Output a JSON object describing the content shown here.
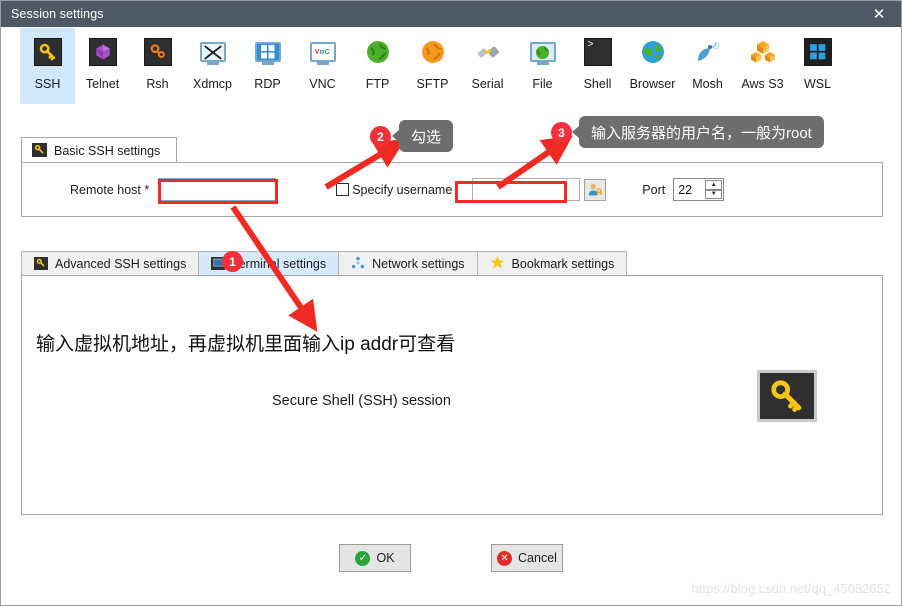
{
  "window": {
    "title": "Session settings",
    "close_icon": "close-icon"
  },
  "protocols": {
    "selected": "SSH",
    "items": [
      {
        "label": "SSH",
        "icon": "key-icon"
      },
      {
        "label": "Telnet",
        "icon": "purple-cube-icon"
      },
      {
        "label": "Rsh",
        "icon": "orange-gears-icon"
      },
      {
        "label": "Xdmcp",
        "icon": "monitor-x-icon"
      },
      {
        "label": "RDP",
        "icon": "monitor-windows-icon"
      },
      {
        "label": "VNC",
        "icon": "monitor-vnc-icon"
      },
      {
        "label": "FTP",
        "icon": "green-globe-icon"
      },
      {
        "label": "SFTP",
        "icon": "orange-globe-icon"
      },
      {
        "label": "Serial",
        "icon": "plug-connector-icon"
      },
      {
        "label": "File",
        "icon": "monitor-globe-icon"
      },
      {
        "label": "Shell",
        "icon": "terminal-prompt-icon"
      },
      {
        "label": "Browser",
        "icon": "blue-globe-icon"
      },
      {
        "label": "Mosh",
        "icon": "satellite-dish-icon"
      },
      {
        "label": "Aws S3",
        "icon": "aws-cubes-icon"
      },
      {
        "label": "WSL",
        "icon": "windows-logo-icon"
      }
    ]
  },
  "basic_group": {
    "tab_label": "Basic SSH settings",
    "tab_icon": "key-icon",
    "remote_host_label": "Remote host *",
    "remote_host_value": "",
    "remote_host_placeholder": "",
    "specify_username_label": "Specify username",
    "specify_username_checked": false,
    "username_value": "",
    "username_placeholder": "",
    "username_browse_icon": "user-key-icon",
    "port_label": "Port",
    "port_value": "22",
    "spin_up_icon": "chevron-up-icon",
    "spin_down_icon": "chevron-down-icon"
  },
  "lower_tabs": {
    "active": "Terminal settings",
    "items": [
      {
        "label": "Advanced SSH settings",
        "icon": "key-icon",
        "active": false
      },
      {
        "label": "Terminal settings",
        "icon": "terminal-icon",
        "active": true
      },
      {
        "label": "Network settings",
        "icon": "network-icon",
        "active": false
      },
      {
        "label": "Bookmark settings",
        "icon": "star-icon",
        "active": false
      }
    ]
  },
  "content": {
    "annotation_text": "输入虚拟机地址，再虚拟机里面输入ip addr可查看",
    "session_caption": "Secure Shell (SSH) session",
    "key_icon": "key-icon"
  },
  "footer": {
    "ok_label": "OK",
    "ok_icon": "check-circle-icon",
    "cancel_label": "Cancel",
    "cancel_icon": "x-circle-icon"
  },
  "annotations": {
    "badge1": "1",
    "badge2": "2",
    "badge3": "3",
    "tooltip2": "勾选",
    "tooltip3": "输入服务器的用户名，一般为root",
    "highlight_color": "#ef2b24",
    "badge_color": "#f0313a",
    "tooltip_bg": "#6e6e6e"
  },
  "watermark": "https://blog.csdn.net/qq_45082652"
}
